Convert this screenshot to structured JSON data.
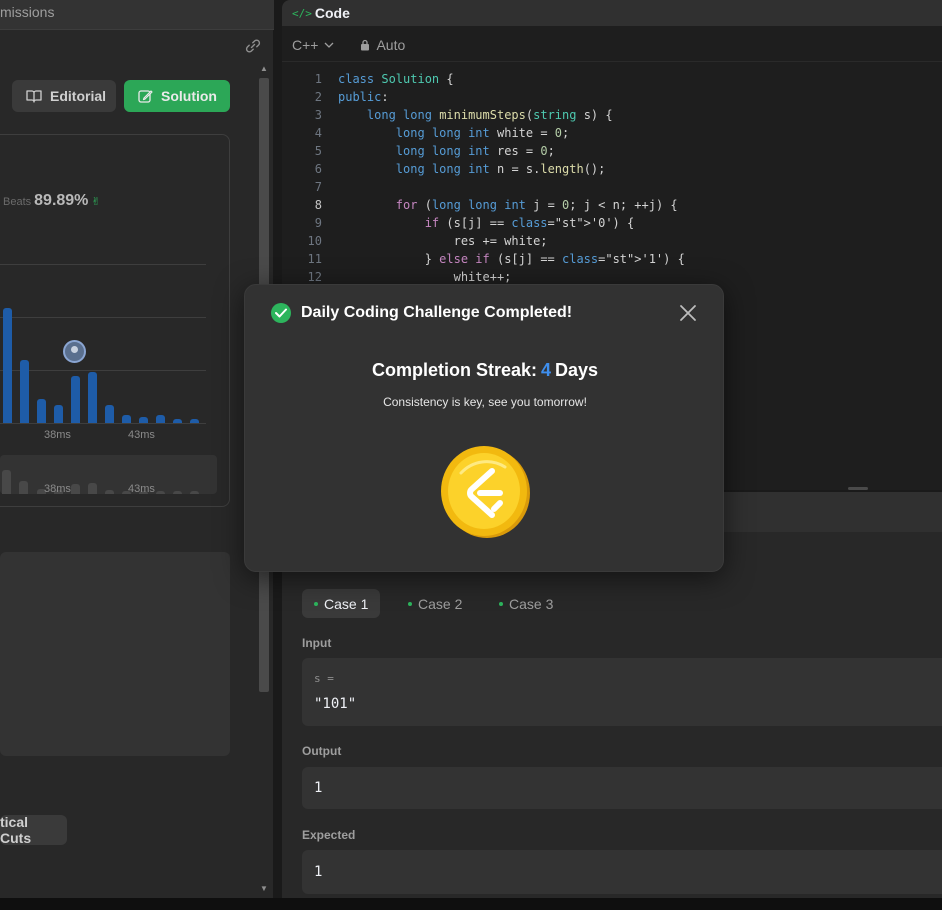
{
  "left_panel": {
    "tab_title": "missions",
    "editorial_label": "Editorial",
    "solution_label": "Solution",
    "beats_label": "Beats",
    "beats_value": "89.89%",
    "tag_label": "tical Cuts"
  },
  "chart_data": {
    "type": "bar",
    "x_ticks": [
      "38ms",
      "43ms"
    ],
    "mini_x_ticks": [
      "38ms",
      "43ms"
    ],
    "bars": [
      {
        "label": "b1",
        "value": 115
      },
      {
        "label": "b2",
        "value": 63
      },
      {
        "label": "b3",
        "value": 24
      },
      {
        "label": "b4",
        "value": 18
      },
      {
        "label": "b5",
        "value": 47
      },
      {
        "label": "b6",
        "value": 51
      },
      {
        "label": "b7",
        "value": 18
      },
      {
        "label": "b8",
        "value": 8
      },
      {
        "label": "b9",
        "value": 6
      },
      {
        "label": "b10",
        "value": 8
      },
      {
        "label": "b11",
        "value": 4
      },
      {
        "label": "b12",
        "value": 4
      }
    ],
    "highlight_index": 4,
    "ylim": [
      0,
      160
    ]
  },
  "code_panel": {
    "title": "Code",
    "language": "C++",
    "mode": "Auto",
    "lines": [
      {
        "n": "1",
        "t": "class Solution {"
      },
      {
        "n": "2",
        "t": "public:"
      },
      {
        "n": "3",
        "t": "    long long minimumSteps(string s) {"
      },
      {
        "n": "4",
        "t": "        long long int white = 0;"
      },
      {
        "n": "5",
        "t": "        long long int res = 0;"
      },
      {
        "n": "6",
        "t": "        long long int n = s.length();"
      },
      {
        "n": "7",
        "t": ""
      },
      {
        "n": "8",
        "t": "        for (long long int j = 0; j < n; ++j) {"
      },
      {
        "n": "9",
        "t": "            if (s[j] == '0') {"
      },
      {
        "n": "10",
        "t": "                res += white;"
      },
      {
        "n": "11",
        "t": "            } else if (s[j] == '1') {"
      },
      {
        "n": "12",
        "t": "                white++;"
      }
    ]
  },
  "test_panel": {
    "cases": [
      "Case 1",
      "Case 2",
      "Case 3"
    ],
    "active_case": 0,
    "input_label": "Input",
    "input_var": "s =",
    "input_value": "\"101\"",
    "output_label": "Output",
    "output_value": "1",
    "expected_label": "Expected",
    "expected_value": "1"
  },
  "modal": {
    "title": "Daily Coding Challenge Completed!",
    "streak_prefix": "Completion Streak:",
    "streak_count": "4",
    "streak_suffix": "Days",
    "subtitle": "Consistency is key, see you tomorrow!"
  },
  "colors": {
    "accent_green": "#2db55d",
    "accent_blue": "#3e8eed",
    "bar_blue": "#1e5ca8",
    "coin_gold": "#f5c518"
  }
}
